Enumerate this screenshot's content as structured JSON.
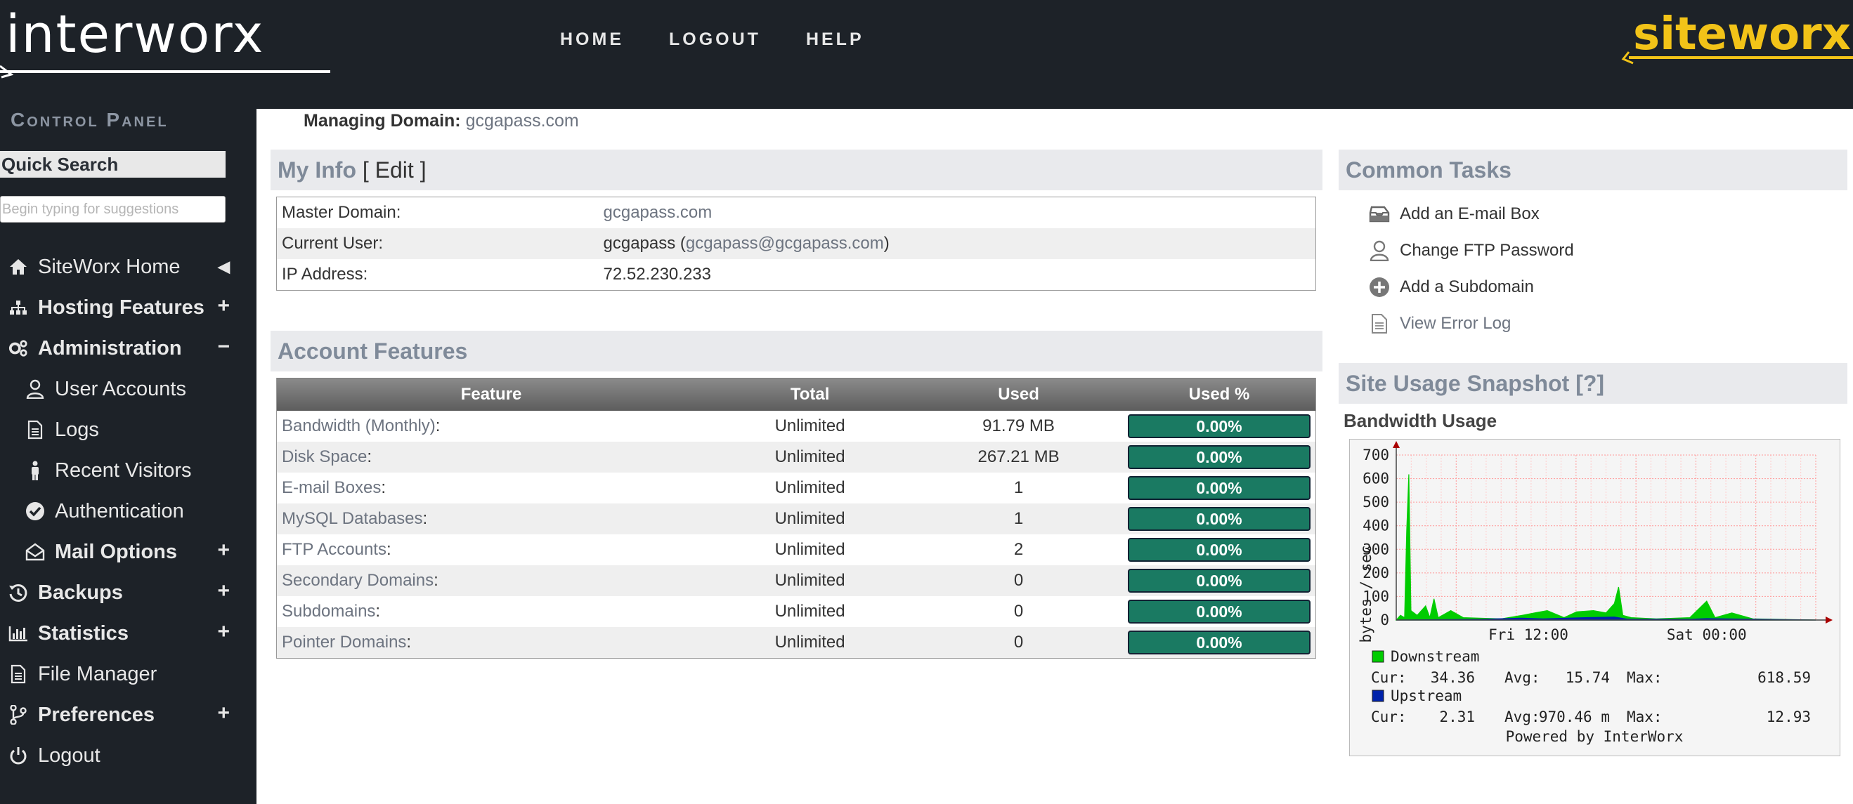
{
  "header": {
    "logo_left": "interworx",
    "logo_right": "siteworx",
    "nav": [
      "HOME",
      "LOGOUT",
      "HELP"
    ]
  },
  "sidebar": {
    "title": "Control Panel",
    "quick_search_label": "Quick Search",
    "quick_search_placeholder": "Begin typing for suggestions",
    "items": [
      {
        "label": "SiteWorx Home",
        "icon": "home-icon",
        "right": "◀"
      },
      {
        "label": "Hosting Features",
        "icon": "sitemap-icon",
        "right": "+"
      },
      {
        "label": "Administration",
        "icon": "gears-icon",
        "right": "−"
      },
      {
        "label": "User Accounts",
        "icon": "user-icon"
      },
      {
        "label": "Logs",
        "icon": "document-icon"
      },
      {
        "label": "Recent Visitors",
        "icon": "person-icon"
      },
      {
        "label": "Authentication",
        "icon": "check-circle-icon"
      },
      {
        "label": "Mail Options",
        "icon": "envelope-open-icon",
        "right": "+"
      },
      {
        "label": "Backups",
        "icon": "history-icon",
        "right": "+"
      },
      {
        "label": "Statistics",
        "icon": "bar-chart-icon",
        "right": "+"
      },
      {
        "label": "File Manager",
        "icon": "document-icon"
      },
      {
        "label": "Preferences",
        "icon": "branch-icon",
        "right": "+"
      },
      {
        "label": "Logout",
        "icon": "power-icon"
      }
    ]
  },
  "managing": {
    "label": "Managing Domain:",
    "domain": "gcgapass.com"
  },
  "my_info": {
    "title": "My Info",
    "edit": "[ Edit ]",
    "rows": [
      {
        "label": "Master Domain:",
        "value": "gcgapass.com"
      },
      {
        "label": "Current User:",
        "value": "gcgapass",
        "email": "gcgapass@gcgapass.com"
      },
      {
        "label": "IP Address:",
        "value": "72.52.230.233"
      }
    ]
  },
  "account_features": {
    "title": "Account Features",
    "columns": [
      "Feature",
      "Total",
      "Used",
      "Used %"
    ],
    "rows": [
      {
        "feature": "Bandwidth (Monthly)",
        "total": "Unlimited",
        "used": "91.79 MB",
        "pct": "0.00%"
      },
      {
        "feature": "Disk Space",
        "total": "Unlimited",
        "used": "267.21 MB",
        "pct": "0.00%"
      },
      {
        "feature": "E-mail Boxes",
        "total": "Unlimited",
        "used": "1",
        "pct": "0.00%"
      },
      {
        "feature": "MySQL Databases",
        "total": "Unlimited",
        "used": "1",
        "pct": "0.00%"
      },
      {
        "feature": "FTP Accounts",
        "total": "Unlimited",
        "used": "2",
        "pct": "0.00%"
      },
      {
        "feature": "Secondary Domains",
        "total": "Unlimited",
        "used": "0",
        "pct": "0.00%"
      },
      {
        "feature": "Subdomains",
        "total": "Unlimited",
        "used": "0",
        "pct": "0.00%"
      },
      {
        "feature": "Pointer Domains",
        "total": "Unlimited",
        "used": "0",
        "pct": "0.00%"
      }
    ]
  },
  "common_tasks": {
    "title": "Common Tasks",
    "items": [
      {
        "label": "Add an E-mail Box",
        "icon": "inbox-icon"
      },
      {
        "label": "Change FTP Password",
        "icon": "user-icon"
      },
      {
        "label": "Add a Subdomain",
        "icon": "plus-circle-icon"
      },
      {
        "label": "View Error Log",
        "icon": "document-icon"
      }
    ]
  },
  "site_usage": {
    "title": "Site Usage Snapshot [?]",
    "bandwidth_title": "Bandwidth Usage",
    "legend": [
      {
        "name": "Downstream",
        "color": "#00cc00",
        "cur": "34.36",
        "avg": "15.74",
        "max": "618.59"
      },
      {
        "name": "Upstream",
        "color": "#0022aa",
        "cur": "2.31",
        "avg": "970.46 m",
        "max": "12.93"
      }
    ],
    "powered": "Powered by InterWorx",
    "labels": {
      "cur": "Cur:",
      "avg": "Avg:",
      "max": "Max:"
    }
  },
  "chart_data": {
    "type": "area",
    "ylabel": "bytes / sec",
    "ylim": [
      0,
      700
    ],
    "yticks": [
      0,
      100,
      200,
      300,
      400,
      500,
      600,
      700
    ],
    "xticks": [
      "Fri 12:00",
      "Sat 00:00"
    ],
    "grid": true,
    "series": [
      {
        "name": "Downstream",
        "color": "#00cc00",
        "points": [
          [
            0.0,
            0
          ],
          [
            0.01,
            20
          ],
          [
            0.02,
            10
          ],
          [
            0.025,
            380
          ],
          [
            0.03,
            618
          ],
          [
            0.035,
            40
          ],
          [
            0.05,
            20
          ],
          [
            0.07,
            60
          ],
          [
            0.08,
            10
          ],
          [
            0.09,
            90
          ],
          [
            0.1,
            10
          ],
          [
            0.13,
            40
          ],
          [
            0.16,
            10
          ],
          [
            0.25,
            5
          ],
          [
            0.3,
            20
          ],
          [
            0.33,
            30
          ],
          [
            0.36,
            40
          ],
          [
            0.4,
            10
          ],
          [
            0.43,
            35
          ],
          [
            0.47,
            40
          ],
          [
            0.5,
            30
          ],
          [
            0.52,
            70
          ],
          [
            0.53,
            140
          ],
          [
            0.54,
            20
          ],
          [
            0.56,
            10
          ],
          [
            0.62,
            5
          ],
          [
            0.7,
            10
          ],
          [
            0.74,
            80
          ],
          [
            0.76,
            10
          ],
          [
            0.8,
            30
          ],
          [
            0.85,
            5
          ],
          [
            1.0,
            0
          ]
        ]
      },
      {
        "name": "Upstream",
        "color": "#0022aa",
        "points": [
          [
            0.0,
            0
          ],
          [
            0.2,
            3
          ],
          [
            0.3,
            8
          ],
          [
            0.35,
            5
          ],
          [
            0.45,
            10
          ],
          [
            0.52,
            12.9
          ],
          [
            0.55,
            4
          ],
          [
            0.7,
            3
          ],
          [
            0.74,
            6
          ],
          [
            1.0,
            0
          ]
        ]
      }
    ]
  }
}
